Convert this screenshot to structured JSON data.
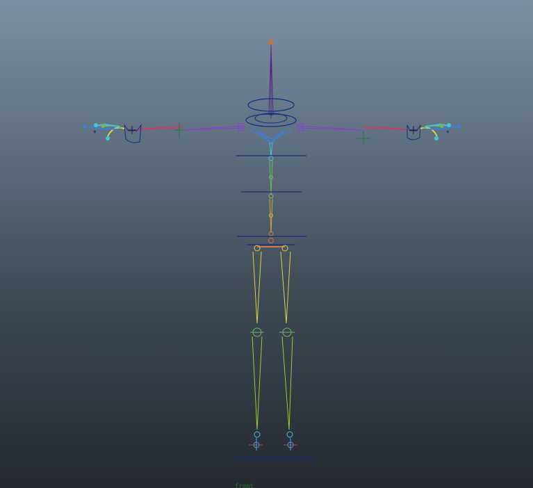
{
  "viewport": {
    "camera_label": "front",
    "background_top": "#7c8fa4",
    "background_bottom": "#24292f"
  },
  "colors": {
    "control_curve": "#0f2f86",
    "spine_joint": "#3d7fd6",
    "chest_joint": "#45c6d0",
    "mid_spine": "#6db56a",
    "hip_joint": "#cc7a3a",
    "leg_upper": "#d8d44a",
    "leg_lower": "#9acd32",
    "arm_upper": "#8a3fd0",
    "arm_lower": "#d8345c",
    "head_joint": "#4a2a7a",
    "foot_joint": "#3aa8d8"
  }
}
